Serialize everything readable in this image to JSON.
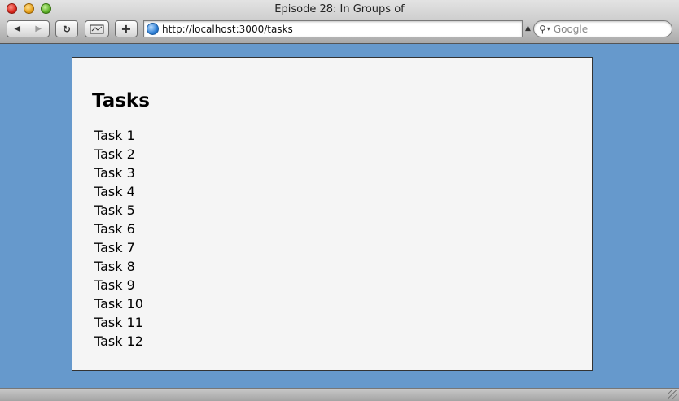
{
  "window": {
    "title": "Episode 28: In Groups of"
  },
  "toolbar": {
    "back_icon": "◀",
    "forward_icon": "▶",
    "reload_icon": "↻",
    "add_icon": "+",
    "url": "http://localhost:3000/tasks",
    "search_placeholder": "Google"
  },
  "page": {
    "heading": "Tasks",
    "tasks": [
      "Task 1",
      "Task 2",
      "Task 3",
      "Task 4",
      "Task 5",
      "Task 6",
      "Task 7",
      "Task 8",
      "Task 9",
      "Task 10",
      "Task 11",
      "Task 12"
    ]
  },
  "colors": {
    "desktop_background": "#6699cc",
    "page_background": "#f5f5f5"
  }
}
